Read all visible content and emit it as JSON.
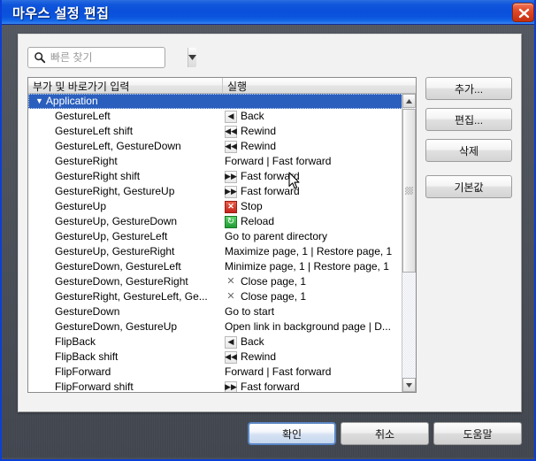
{
  "window": {
    "title": "마우스 설정 편집",
    "close_label": "close-icon"
  },
  "search": {
    "placeholder": "빠른 찾기",
    "value": "",
    "icon": "search-icon",
    "dropdown_icon": "chevron-down-icon"
  },
  "list": {
    "headers": [
      "부가 및 바로가기 입력",
      "실행"
    ],
    "rows": [
      {
        "group": true,
        "key": "Application",
        "action": "",
        "icon": ""
      },
      {
        "group": false,
        "key": "GestureLeft",
        "action": "Back",
        "icon": "back-arrow-icon"
      },
      {
        "group": false,
        "key": "GestureLeft shift",
        "action": "Rewind",
        "icon": "rewind-icon"
      },
      {
        "group": false,
        "key": "GestureLeft, GestureDown",
        "action": "Rewind",
        "icon": "rewind-icon"
      },
      {
        "group": false,
        "key": "GestureRight",
        "action": "Forward | Fast forward",
        "icon": ""
      },
      {
        "group": false,
        "key": "GestureRight shift",
        "action": "Fast forward",
        "icon": "fast-forward-icon"
      },
      {
        "group": false,
        "key": "GestureRight, GestureUp",
        "action": "Fast forward",
        "icon": "fast-forward-icon"
      },
      {
        "group": false,
        "key": "GestureUp",
        "action": "Stop",
        "icon": "stop-icon"
      },
      {
        "group": false,
        "key": "GestureUp, GestureDown",
        "action": "Reload",
        "icon": "reload-icon"
      },
      {
        "group": false,
        "key": "GestureUp, GestureLeft",
        "action": "Go to parent directory",
        "icon": ""
      },
      {
        "group": false,
        "key": "GestureUp, GestureRight",
        "action": "Maximize page, 1 | Restore page, 1",
        "icon": ""
      },
      {
        "group": false,
        "key": "GestureDown, GestureLeft",
        "action": "Minimize page, 1 | Restore page, 1",
        "icon": ""
      },
      {
        "group": false,
        "key": "GestureDown, GestureRight",
        "action": "Close page, 1",
        "icon": "close-small-icon"
      },
      {
        "group": false,
        "key": "GestureRight, GestureLeft, Ge...",
        "action": "Close page, 1",
        "icon": "close-small-icon"
      },
      {
        "group": false,
        "key": "GestureDown",
        "action": "Go to start",
        "icon": ""
      },
      {
        "group": false,
        "key": "GestureDown, GestureUp",
        "action": "Open link in background page | D...",
        "icon": ""
      },
      {
        "group": false,
        "key": "FlipBack",
        "action": "Back",
        "icon": "back-arrow-icon"
      },
      {
        "group": false,
        "key": "FlipBack shift",
        "action": "Rewind",
        "icon": "rewind-icon"
      },
      {
        "group": false,
        "key": "FlipForward",
        "action": "Forward | Fast forward",
        "icon": ""
      },
      {
        "group": false,
        "key": "FlipForward shift",
        "action": "Fast forward",
        "icon": "fast-forward-icon"
      }
    ]
  },
  "side_buttons": {
    "add": "추가...",
    "edit": "편집...",
    "delete": "삭제",
    "default": "기본값"
  },
  "bottom_buttons": {
    "ok": "확인",
    "cancel": "취소",
    "help": "도움말"
  },
  "colors": {
    "titlebar_blue": "#0a4fda",
    "selection_blue": "#2b5fbe",
    "window_body": "#474c55",
    "close_red": "#c5231a",
    "reload_green": "#1f9c34"
  }
}
